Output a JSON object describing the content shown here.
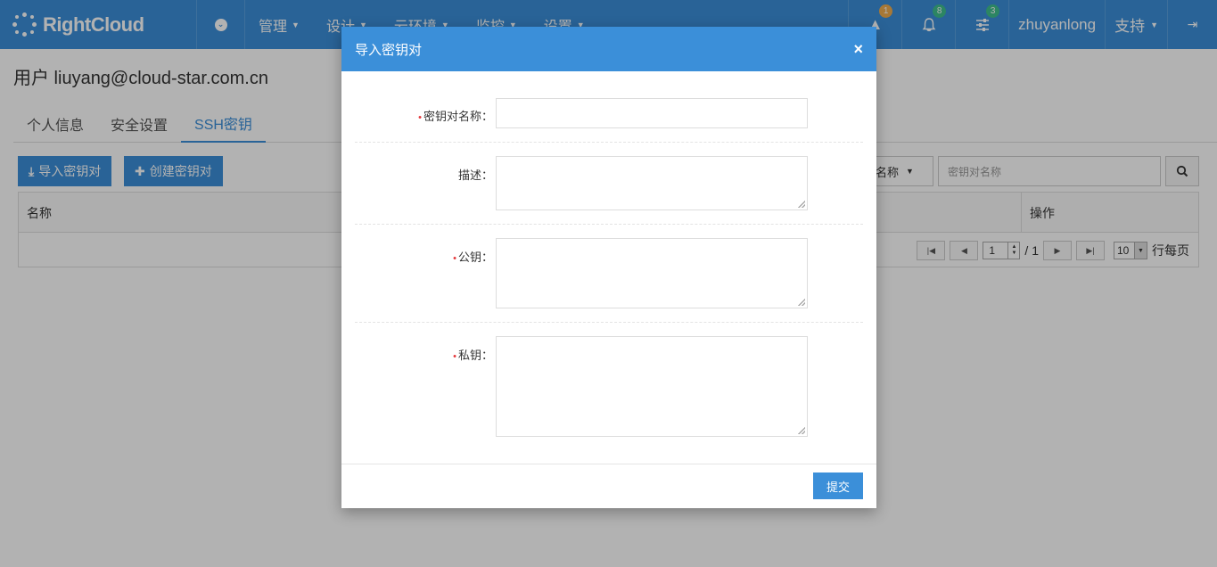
{
  "colors": {
    "primary": "#3b8fd9",
    "required": "#e4393c",
    "badge_warning": "#f0ad4e",
    "badge_success": "#3fbf8f"
  },
  "brand": {
    "name": "RightCloud"
  },
  "nav": {
    "menu": [
      {
        "label": "管理"
      },
      {
        "label": "设计"
      },
      {
        "label": "云环境"
      },
      {
        "label": "监控"
      },
      {
        "label": "设置"
      }
    ],
    "alerts": {
      "count": "1"
    },
    "notifications": {
      "count": "8"
    },
    "tasks": {
      "count": "3"
    },
    "username": "zhuyanlong",
    "support": "支持"
  },
  "page": {
    "title": "用户 liuyang@cloud-star.com.cn",
    "tabs": [
      {
        "label": "个人信息"
      },
      {
        "label": "安全设置"
      },
      {
        "label": "SSH密钥"
      }
    ],
    "active_tab": "SSH密钥",
    "toolbar": {
      "import_label": "导入密钥对",
      "create_label": "创建密钥对",
      "filter_value": "对名称",
      "search_placeholder": "密钥对名称"
    },
    "table": {
      "columns": [
        "名称",
        "操作"
      ]
    },
    "pager": {
      "page": "1",
      "total": "/ 1",
      "page_size": "10",
      "per_page_label": "行每页"
    }
  },
  "modal": {
    "title": "导入密钥对",
    "close_glyph": "×",
    "fields": [
      {
        "label": "密钥对名称：",
        "required": true
      },
      {
        "label": "描述：",
        "required": false
      },
      {
        "label": "公钥：",
        "required": true
      },
      {
        "label": "私钥：",
        "required": true
      }
    ],
    "required_mark": "•",
    "submit_label": "提交"
  }
}
